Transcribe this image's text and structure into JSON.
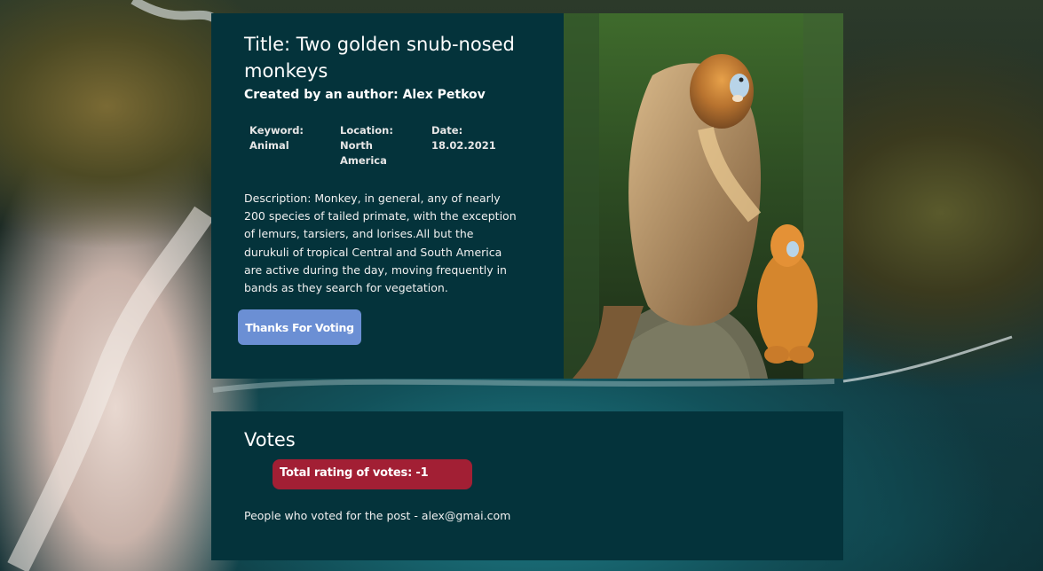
{
  "post": {
    "title": "Title: Two golden snub-nosed monkeys",
    "author": "Created by an author: Alex Petkov",
    "keyword": "Keyword: Animal",
    "location": "Location: North America",
    "date": "Date: 18.02.2021",
    "description": "Description: Monkey, in general, any of nearly 200 species of tailed primate, with the exception of lemurs, tarsiers, and lorises.All but the durukuli of tropical Central and South America are active during the day, moving frequently in bands as they search for vegetation.",
    "vote_button_label": "Thanks For Voting"
  },
  "votes": {
    "heading": "Votes",
    "total_rating": "Total rating of votes: -1",
    "voters_text": "People who voted for the post - alex@gmai.com"
  },
  "colors": {
    "panel": "#04333b",
    "vote_button": "#6b8fd4",
    "rating_badge": "#a21f34"
  }
}
